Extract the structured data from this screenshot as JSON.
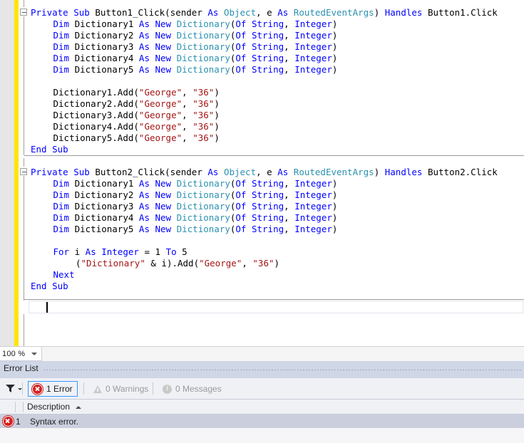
{
  "editor": {
    "zoom_level": "100 %",
    "zoom_dropdown_icon": "chevron-down-icon",
    "lines": [
      {
        "indent": 0,
        "tokens": [
          {
            "t": "Private ",
            "c": "kw"
          },
          {
            "t": "Sub ",
            "c": "kw"
          },
          {
            "t": "Button1_Click(sender ",
            "c": "pln"
          },
          {
            "t": "As ",
            "c": "kw"
          },
          {
            "t": "Object",
            "c": "typ"
          },
          {
            "t": ", e ",
            "c": "pln"
          },
          {
            "t": "As ",
            "c": "kw"
          },
          {
            "t": "RoutedEventArgs",
            "c": "typ"
          },
          {
            "t": ") ",
            "c": "pln"
          },
          {
            "t": "Handles ",
            "c": "kw"
          },
          {
            "t": "Button1.Click",
            "c": "pln"
          }
        ]
      },
      {
        "indent": 1,
        "tokens": [
          {
            "t": "Dim ",
            "c": "kw"
          },
          {
            "t": "Dictionary1 ",
            "c": "pln"
          },
          {
            "t": "As ",
            "c": "kw"
          },
          {
            "t": "New ",
            "c": "kw"
          },
          {
            "t": "Dictionary",
            "c": "typ"
          },
          {
            "t": "(",
            "c": "pln"
          },
          {
            "t": "Of ",
            "c": "kw"
          },
          {
            "t": "String",
            "c": "kw"
          },
          {
            "t": ", ",
            "c": "pln"
          },
          {
            "t": "Integer",
            "c": "kw"
          },
          {
            "t": ")",
            "c": "pln"
          }
        ]
      },
      {
        "indent": 1,
        "tokens": [
          {
            "t": "Dim ",
            "c": "kw"
          },
          {
            "t": "Dictionary2 ",
            "c": "pln"
          },
          {
            "t": "As ",
            "c": "kw"
          },
          {
            "t": "New ",
            "c": "kw"
          },
          {
            "t": "Dictionary",
            "c": "typ"
          },
          {
            "t": "(",
            "c": "pln"
          },
          {
            "t": "Of ",
            "c": "kw"
          },
          {
            "t": "String",
            "c": "kw"
          },
          {
            "t": ", ",
            "c": "pln"
          },
          {
            "t": "Integer",
            "c": "kw"
          },
          {
            "t": ")",
            "c": "pln"
          }
        ]
      },
      {
        "indent": 1,
        "tokens": [
          {
            "t": "Dim ",
            "c": "kw"
          },
          {
            "t": "Dictionary3 ",
            "c": "pln"
          },
          {
            "t": "As ",
            "c": "kw"
          },
          {
            "t": "New ",
            "c": "kw"
          },
          {
            "t": "Dictionary",
            "c": "typ"
          },
          {
            "t": "(",
            "c": "pln"
          },
          {
            "t": "Of ",
            "c": "kw"
          },
          {
            "t": "String",
            "c": "kw"
          },
          {
            "t": ", ",
            "c": "pln"
          },
          {
            "t": "Integer",
            "c": "kw"
          },
          {
            "t": ")",
            "c": "pln"
          }
        ]
      },
      {
        "indent": 1,
        "tokens": [
          {
            "t": "Dim ",
            "c": "kw"
          },
          {
            "t": "Dictionary4 ",
            "c": "pln"
          },
          {
            "t": "As ",
            "c": "kw"
          },
          {
            "t": "New ",
            "c": "kw"
          },
          {
            "t": "Dictionary",
            "c": "typ"
          },
          {
            "t": "(",
            "c": "pln"
          },
          {
            "t": "Of ",
            "c": "kw"
          },
          {
            "t": "String",
            "c": "kw"
          },
          {
            "t": ", ",
            "c": "pln"
          },
          {
            "t": "Integer",
            "c": "kw"
          },
          {
            "t": ")",
            "c": "pln"
          }
        ]
      },
      {
        "indent": 1,
        "tokens": [
          {
            "t": "Dim ",
            "c": "kw"
          },
          {
            "t": "Dictionary5 ",
            "c": "pln"
          },
          {
            "t": "As ",
            "c": "kw"
          },
          {
            "t": "New ",
            "c": "kw"
          },
          {
            "t": "Dictionary",
            "c": "typ"
          },
          {
            "t": "(",
            "c": "pln"
          },
          {
            "t": "Of ",
            "c": "kw"
          },
          {
            "t": "String",
            "c": "kw"
          },
          {
            "t": ", ",
            "c": "pln"
          },
          {
            "t": "Integer",
            "c": "kw"
          },
          {
            "t": ")",
            "c": "pln"
          }
        ]
      },
      {
        "indent": 0,
        "tokens": []
      },
      {
        "indent": 1,
        "tokens": [
          {
            "t": "Dictionary1.Add(",
            "c": "pln"
          },
          {
            "t": "\"George\"",
            "c": "str"
          },
          {
            "t": ", ",
            "c": "pln"
          },
          {
            "t": "\"36\"",
            "c": "str"
          },
          {
            "t": ")",
            "c": "pln"
          }
        ]
      },
      {
        "indent": 1,
        "tokens": [
          {
            "t": "Dictionary2.Add(",
            "c": "pln"
          },
          {
            "t": "\"George\"",
            "c": "str"
          },
          {
            "t": ", ",
            "c": "pln"
          },
          {
            "t": "\"36\"",
            "c": "str"
          },
          {
            "t": ")",
            "c": "pln"
          }
        ]
      },
      {
        "indent": 1,
        "tokens": [
          {
            "t": "Dictionary3.Add(",
            "c": "pln"
          },
          {
            "t": "\"George\"",
            "c": "str"
          },
          {
            "t": ", ",
            "c": "pln"
          },
          {
            "t": "\"36\"",
            "c": "str"
          },
          {
            "t": ")",
            "c": "pln"
          }
        ]
      },
      {
        "indent": 1,
        "tokens": [
          {
            "t": "Dictionary4.Add(",
            "c": "pln"
          },
          {
            "t": "\"George\"",
            "c": "str"
          },
          {
            "t": ", ",
            "c": "pln"
          },
          {
            "t": "\"36\"",
            "c": "str"
          },
          {
            "t": ")",
            "c": "pln"
          }
        ]
      },
      {
        "indent": 1,
        "tokens": [
          {
            "t": "Dictionary5.Add(",
            "c": "pln"
          },
          {
            "t": "\"George\"",
            "c": "str"
          },
          {
            "t": ", ",
            "c": "pln"
          },
          {
            "t": "\"36\"",
            "c": "str"
          },
          {
            "t": ")",
            "c": "pln"
          }
        ]
      },
      {
        "indent": 0,
        "tokens": [
          {
            "t": "End ",
            "c": "kw"
          },
          {
            "t": "Sub",
            "c": "kw"
          }
        ]
      },
      {
        "indent": 0,
        "tokens": []
      },
      {
        "indent": 0,
        "tokens": [
          {
            "t": "Private ",
            "c": "kw"
          },
          {
            "t": "Sub ",
            "c": "kw"
          },
          {
            "t": "Button2_Click(sender ",
            "c": "pln"
          },
          {
            "t": "As ",
            "c": "kw"
          },
          {
            "t": "Object",
            "c": "typ"
          },
          {
            "t": ", e ",
            "c": "pln"
          },
          {
            "t": "As ",
            "c": "kw"
          },
          {
            "t": "RoutedEventArgs",
            "c": "typ"
          },
          {
            "t": ") ",
            "c": "pln"
          },
          {
            "t": "Handles ",
            "c": "kw"
          },
          {
            "t": "Button2.Click",
            "c": "pln"
          }
        ]
      },
      {
        "indent": 1,
        "tokens": [
          {
            "t": "Dim ",
            "c": "kw"
          },
          {
            "t": "Dictionary1 ",
            "c": "pln"
          },
          {
            "t": "As ",
            "c": "kw"
          },
          {
            "t": "New ",
            "c": "kw"
          },
          {
            "t": "Dictionary",
            "c": "typ"
          },
          {
            "t": "(",
            "c": "pln"
          },
          {
            "t": "Of ",
            "c": "kw"
          },
          {
            "t": "String",
            "c": "kw"
          },
          {
            "t": ", ",
            "c": "pln"
          },
          {
            "t": "Integer",
            "c": "kw"
          },
          {
            "t": ")",
            "c": "pln"
          }
        ]
      },
      {
        "indent": 1,
        "tokens": [
          {
            "t": "Dim ",
            "c": "kw"
          },
          {
            "t": "Dictionary2 ",
            "c": "pln"
          },
          {
            "t": "As ",
            "c": "kw"
          },
          {
            "t": "New ",
            "c": "kw"
          },
          {
            "t": "Dictionary",
            "c": "typ"
          },
          {
            "t": "(",
            "c": "pln"
          },
          {
            "t": "Of ",
            "c": "kw"
          },
          {
            "t": "String",
            "c": "kw"
          },
          {
            "t": ", ",
            "c": "pln"
          },
          {
            "t": "Integer",
            "c": "kw"
          },
          {
            "t": ")",
            "c": "pln"
          }
        ]
      },
      {
        "indent": 1,
        "tokens": [
          {
            "t": "Dim ",
            "c": "kw"
          },
          {
            "t": "Dictionary3 ",
            "c": "pln"
          },
          {
            "t": "As ",
            "c": "kw"
          },
          {
            "t": "New ",
            "c": "kw"
          },
          {
            "t": "Dictionary",
            "c": "typ"
          },
          {
            "t": "(",
            "c": "pln"
          },
          {
            "t": "Of ",
            "c": "kw"
          },
          {
            "t": "String",
            "c": "kw"
          },
          {
            "t": ", ",
            "c": "pln"
          },
          {
            "t": "Integer",
            "c": "kw"
          },
          {
            "t": ")",
            "c": "pln"
          }
        ]
      },
      {
        "indent": 1,
        "tokens": [
          {
            "t": "Dim ",
            "c": "kw"
          },
          {
            "t": "Dictionary4 ",
            "c": "pln"
          },
          {
            "t": "As ",
            "c": "kw"
          },
          {
            "t": "New ",
            "c": "kw"
          },
          {
            "t": "Dictionary",
            "c": "typ"
          },
          {
            "t": "(",
            "c": "pln"
          },
          {
            "t": "Of ",
            "c": "kw"
          },
          {
            "t": "String",
            "c": "kw"
          },
          {
            "t": ", ",
            "c": "pln"
          },
          {
            "t": "Integer",
            "c": "kw"
          },
          {
            "t": ")",
            "c": "pln"
          }
        ]
      },
      {
        "indent": 1,
        "tokens": [
          {
            "t": "Dim ",
            "c": "kw"
          },
          {
            "t": "Dictionary5 ",
            "c": "pln"
          },
          {
            "t": "As ",
            "c": "kw"
          },
          {
            "t": "New ",
            "c": "kw"
          },
          {
            "t": "Dictionary",
            "c": "typ"
          },
          {
            "t": "(",
            "c": "pln"
          },
          {
            "t": "Of ",
            "c": "kw"
          },
          {
            "t": "String",
            "c": "kw"
          },
          {
            "t": ", ",
            "c": "pln"
          },
          {
            "t": "Integer",
            "c": "kw"
          },
          {
            "t": ")",
            "c": "pln"
          }
        ]
      },
      {
        "indent": 0,
        "tokens": []
      },
      {
        "indent": 1,
        "tokens": [
          {
            "t": "For ",
            "c": "kw"
          },
          {
            "t": "i ",
            "c": "pln"
          },
          {
            "t": "As ",
            "c": "kw"
          },
          {
            "t": "Integer ",
            "c": "kw"
          },
          {
            "t": "= 1 ",
            "c": "pln"
          },
          {
            "t": "To ",
            "c": "kw"
          },
          {
            "t": "5",
            "c": "pln"
          }
        ]
      },
      {
        "indent": 2,
        "tokens": [
          {
            "t": "(",
            "c": "pln"
          },
          {
            "t": "\"Dictionary\"",
            "c": "str"
          },
          {
            "t": " & i).Add(",
            "c": "pln"
          },
          {
            "t": "\"George\"",
            "c": "str"
          },
          {
            "t": ", ",
            "c": "pln"
          },
          {
            "t": "\"36\"",
            "c": "str"
          },
          {
            "t": ")",
            "c": "pln"
          }
        ]
      },
      {
        "indent": 1,
        "tokens": [
          {
            "t": "Next",
            "c": "kw"
          }
        ]
      },
      {
        "indent": 0,
        "tokens": [
          {
            "t": "End ",
            "c": "kw"
          },
          {
            "t": "Sub",
            "c": "kw"
          }
        ]
      }
    ]
  },
  "error_list": {
    "panel_title": "Error List",
    "filter_icon": "filter-funnel-icon",
    "filter_dropdown_icon": "chevron-down-icon",
    "toolbar_buttons": [
      {
        "label": "1 Error",
        "icon": "error-icon",
        "active": true,
        "dimmed": false
      },
      {
        "label": "0 Warnings",
        "icon": "warning-icon",
        "active": false,
        "dimmed": true
      },
      {
        "label": "0 Messages",
        "icon": "info-icon",
        "active": false,
        "dimmed": true
      }
    ],
    "columns": [
      "Description"
    ],
    "sort_column": "Description",
    "sort_direction": "ascending",
    "sort_icon": "sort-ascending-arrow-icon",
    "rows": [
      {
        "icon": "error-icon",
        "number": "1",
        "description": "Syntax error."
      }
    ]
  },
  "colors": {
    "keyword": "#0000ff",
    "type": "#2b91af",
    "string": "#a31515",
    "plain": "#000000",
    "change_bar": "#ffe500",
    "error_red": "#d32020",
    "accent_blue": "#3399ff"
  }
}
